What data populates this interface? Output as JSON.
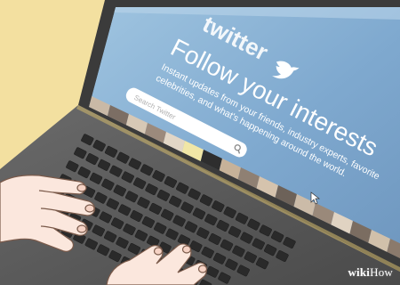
{
  "illustration": {
    "background_color": "#f3e0a0",
    "screen": {
      "logo_text": "twitter",
      "logo_icon": "bird-icon",
      "headline": "Follow your interests",
      "subtext_line1": "Instant updates from your friends, industry experts, favorite",
      "subtext_line2": "celebrities, and what's happening around the world.",
      "search_placeholder": "Search Twitter",
      "search_icon": "magnifier-icon"
    },
    "watermark": {
      "brand_bold": "wiki",
      "brand_rest": "How"
    }
  }
}
